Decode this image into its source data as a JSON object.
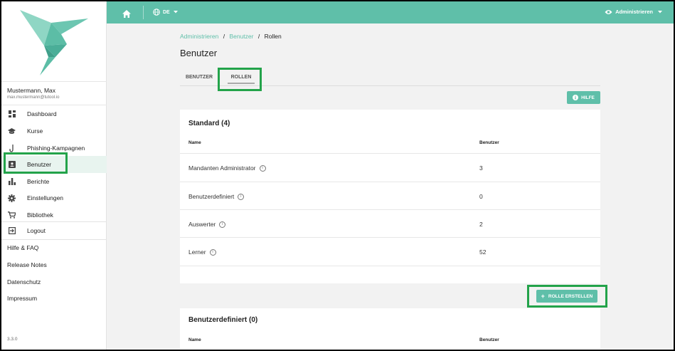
{
  "sidebar": {
    "user_name": "Mustermann, Max",
    "user_email": "max.mustermann@tutool.io",
    "items": [
      {
        "label": "Dashboard",
        "icon": "dashboard-icon"
      },
      {
        "label": "Kurse",
        "icon": "graduation-cap-icon"
      },
      {
        "label": "Phishing-Kampagnen",
        "icon": "fishhook-icon"
      },
      {
        "label": "Benutzer",
        "icon": "contact-card-icon"
      },
      {
        "label": "Berichte",
        "icon": "bar-chart-icon"
      },
      {
        "label": "Einstellungen",
        "icon": "gear-icon"
      },
      {
        "label": "Bibliothek",
        "icon": "cart-icon"
      }
    ],
    "logout": "Logout",
    "links": [
      "Hilfe & FAQ",
      "Release Notes",
      "Datenschutz",
      "Impressum"
    ],
    "version": "3.3.0"
  },
  "topbar": {
    "language": "DE",
    "role": "Administrieren"
  },
  "breadcrumb": {
    "items": [
      "Administrieren",
      "Benutzer",
      "Rollen"
    ],
    "separator": "/"
  },
  "page_title": "Benutzer",
  "tabs": [
    "BENUTZER",
    "ROLLEN"
  ],
  "help_button": "HILFE",
  "standard_card": {
    "title": "Standard (4)",
    "columns": [
      "Name",
      "Benutzer"
    ],
    "rows": [
      {
        "name": "Mandanten Administrator",
        "count": "3"
      },
      {
        "name": "Benutzerdefiniert",
        "count": "0"
      },
      {
        "name": "Auswerter",
        "count": "2"
      },
      {
        "name": "Lerner",
        "count": "52"
      }
    ]
  },
  "create_button": "ROLLE ERSTELLEN",
  "custom_card": {
    "title": "Benutzerdefiniert (0)",
    "columns": [
      "Name",
      "Benutzer"
    ]
  },
  "colors": {
    "accent": "#5fbfa9",
    "highlight": "#23a34a",
    "active_bg": "#e8f4ef"
  }
}
